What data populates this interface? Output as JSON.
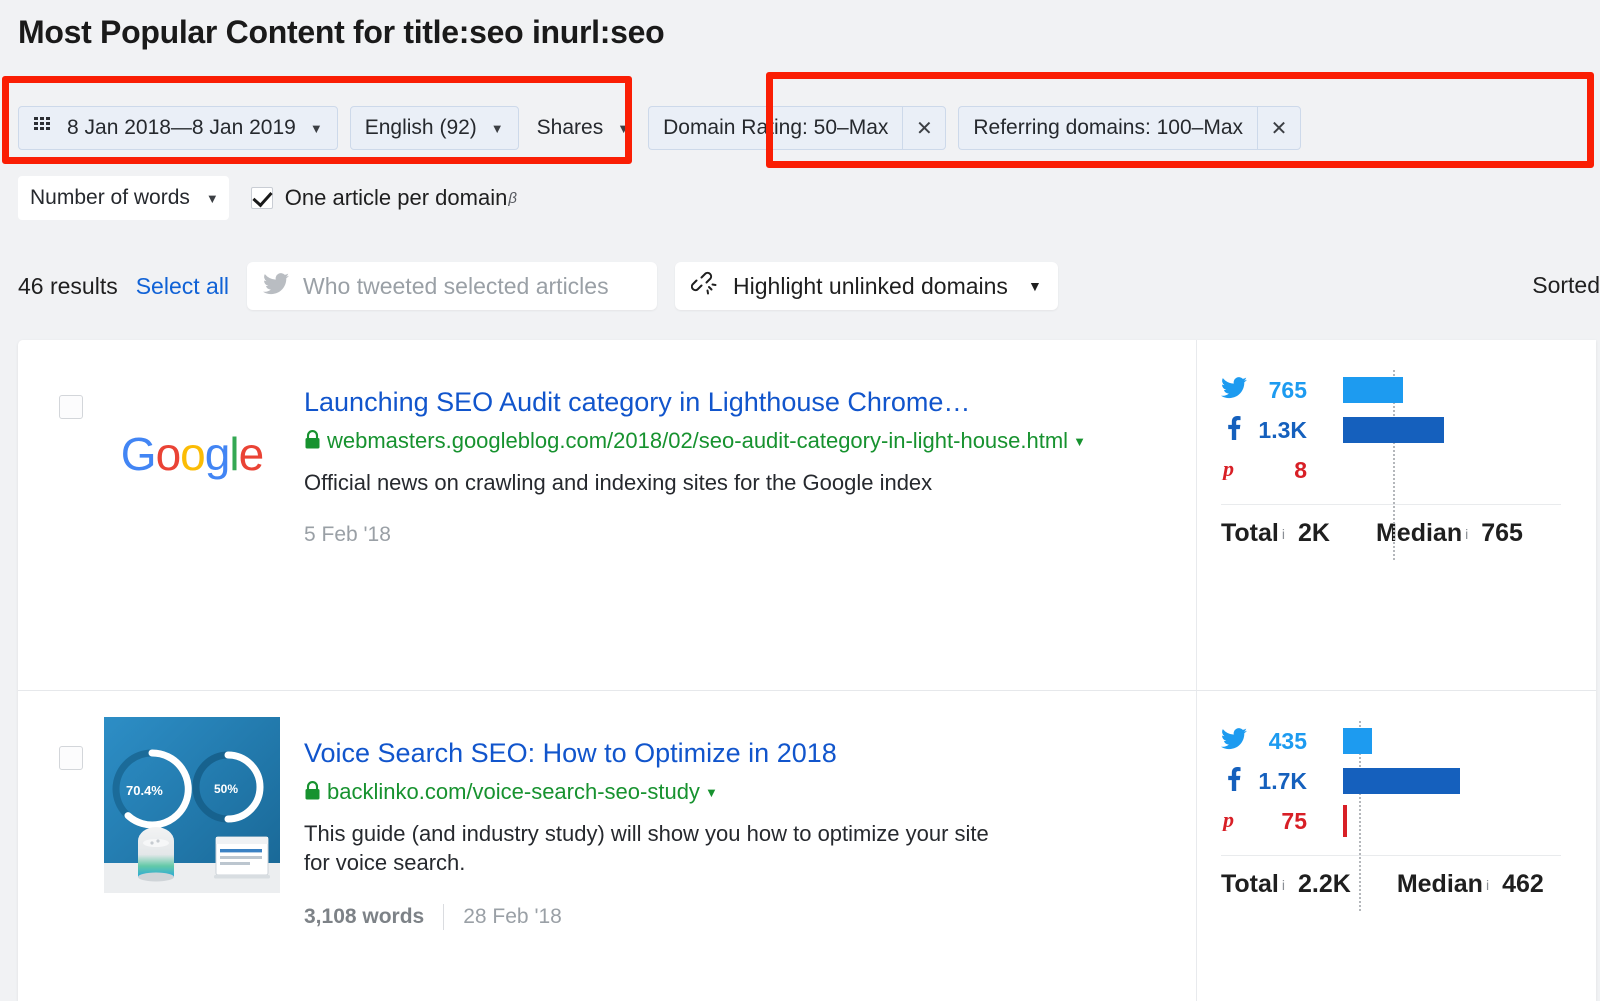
{
  "page": {
    "title": "Most Popular Content for title:seo inurl:seo"
  },
  "filters": {
    "date_range": {
      "label": "8 Jan 2018—8 Jan 2019",
      "icon": "calendar-icon",
      "caret": "▼"
    },
    "language": {
      "label": "English (92)",
      "caret": "▼"
    },
    "shares": {
      "label": "Shares",
      "caret": "▼"
    },
    "domain_rating": {
      "label": "Domain Rating: 50–Max",
      "remove": "✕"
    },
    "referring_domains": {
      "label": "Referring domains: 100–Max",
      "remove": "✕"
    },
    "number_of_words": {
      "label": "Number of words",
      "caret": "▼"
    },
    "one_article_per_domain": {
      "label": "One article per domain",
      "beta": "β",
      "checked": true
    }
  },
  "toolbar": {
    "results_count": "46 results",
    "select_all": "Select all",
    "tweeted_placeholder": "Who tweeted selected articles",
    "tweeted_icon": "twitter-icon",
    "highlight": {
      "label": "Highlight unlinked domains",
      "icon": "broken-link-icon",
      "caret": "▼"
    },
    "sorted": "Sorted"
  },
  "results": [
    {
      "title": "Launching SEO Audit category in Lighthouse Chrome…",
      "url": "webmasters.googleblog.com/2018/02/seo-audit-category-in-light-house.html",
      "description": "Official news on crawling and indexing sites for the Google index",
      "words": "",
      "date": "5 Feb '18",
      "thumbnail": "google-logo",
      "metrics": {
        "twitter": "765",
        "facebook": "1.3K",
        "pinterest": "8",
        "total_label": "Total",
        "total": "2K",
        "median_label": "Median",
        "median": "765"
      },
      "chart_data": {
        "type": "bar",
        "categories": [
          "Twitter",
          "Facebook",
          "Pinterest"
        ],
        "values": [
          765,
          1300,
          8
        ],
        "median": 765,
        "xmax": 1750
      }
    },
    {
      "title": "Voice Search SEO: How to Optimize in 2018",
      "url": "backlinko.com/voice-search-seo-study",
      "description": "This guide (and industry study) will show you how to optimize your site for voice search.",
      "words": "3,108 words",
      "date": "28 Feb '18",
      "thumbnail": "voice-search-study-image",
      "thumbnail_labels": [
        "70.4%",
        "50%"
      ],
      "metrics": {
        "twitter": "435",
        "facebook": "1.7K",
        "pinterest": "75",
        "total_label": "Total",
        "total": "2.2K",
        "median_label": "Median",
        "median": "462"
      },
      "chart_data": {
        "type": "bar",
        "categories": [
          "Twitter",
          "Facebook",
          "Pinterest"
        ],
        "values": [
          435,
          1700,
          75
        ],
        "median": 462,
        "xmax": 2400
      }
    }
  ],
  "colors": {
    "twitter": "#1d9bf0",
    "facebook": "#1560bd",
    "pinterest": "#d81f26",
    "link_blue": "#1155cc",
    "url_green": "#17922f",
    "annotation_red": "#fa1e04"
  }
}
